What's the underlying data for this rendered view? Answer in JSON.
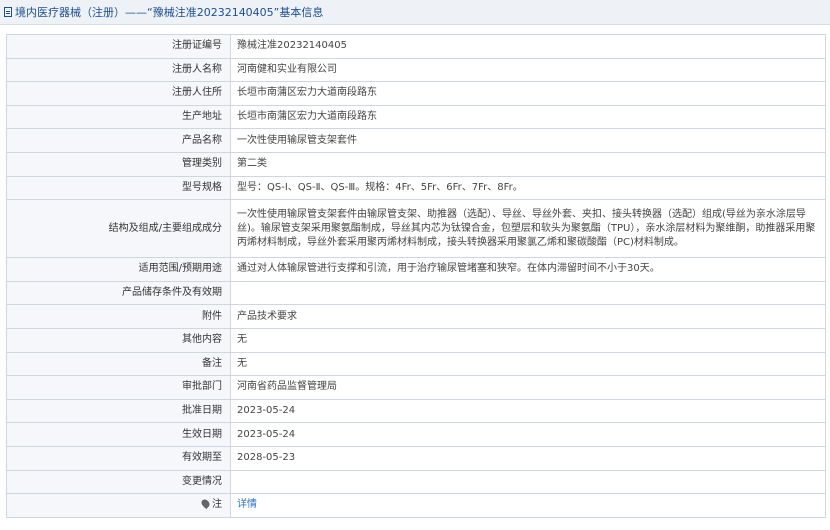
{
  "header": {
    "title": "境内医疗器械（注册）——“豫械注准20232140405”基本信息"
  },
  "rows": [
    {
      "label": "注册证编号",
      "value": "豫械注准20232140405"
    },
    {
      "label": "注册人名称",
      "value": "河南健和实业有限公司"
    },
    {
      "label": "注册人住所",
      "value": "长垣市南蒲区宏力大道南段路东"
    },
    {
      "label": "生产地址",
      "value": "长垣市南蒲区宏力大道南段路东"
    },
    {
      "label": "产品名称",
      "value": "一次性使用输尿管支架套件"
    },
    {
      "label": "管理类别",
      "value": "第二类"
    },
    {
      "label": "型号规格",
      "value": "型号：QS-Ⅰ、QS-Ⅱ、QS-Ⅲ。规格：4Fr、5Fr、6Fr、7Fr、8Fr。"
    },
    {
      "label": "结构及组成/主要组成成分",
      "value": "一次性使用输尿管支架套件由输尿管支架、助推器（选配）、导丝、导丝外套、夹扣、接头转换器（选配）组成(导丝为亲水涂层导丝)。输尿管支架采用聚氨酯制成，导丝其内芯为钛镍合金，包塑层和软头为聚氨酯（TPU），亲水涂层材料为聚维酮，助推器采用聚丙烯材料制成，导丝外套采用聚丙烯材料制成，接头转换器采用聚氯乙烯和聚碳酸酯（PC)材料制成。"
    },
    {
      "label": "适用范围/预期用途",
      "value": "通过对人体输尿管进行支撑和引流，用于治疗输尿管堵塞和狭窄。在体内滞留时间不小于30天。"
    },
    {
      "label": "产品储存条件及有效期",
      "value": ""
    },
    {
      "label": "附件",
      "value": "产品技术要求"
    },
    {
      "label": "其他内容",
      "value": "无"
    },
    {
      "label": "备注",
      "value": "无"
    },
    {
      "label": "审批部门",
      "value": "河南省药品监督管理局"
    },
    {
      "label": "批准日期",
      "value": "2023-05-24"
    },
    {
      "label": "生效日期",
      "value": "2023-05-24"
    },
    {
      "label": "有效期至",
      "value": "2028-05-23"
    },
    {
      "label": "变更情况",
      "value": ""
    }
  ],
  "note": {
    "label": "注",
    "link_text": "详情"
  }
}
